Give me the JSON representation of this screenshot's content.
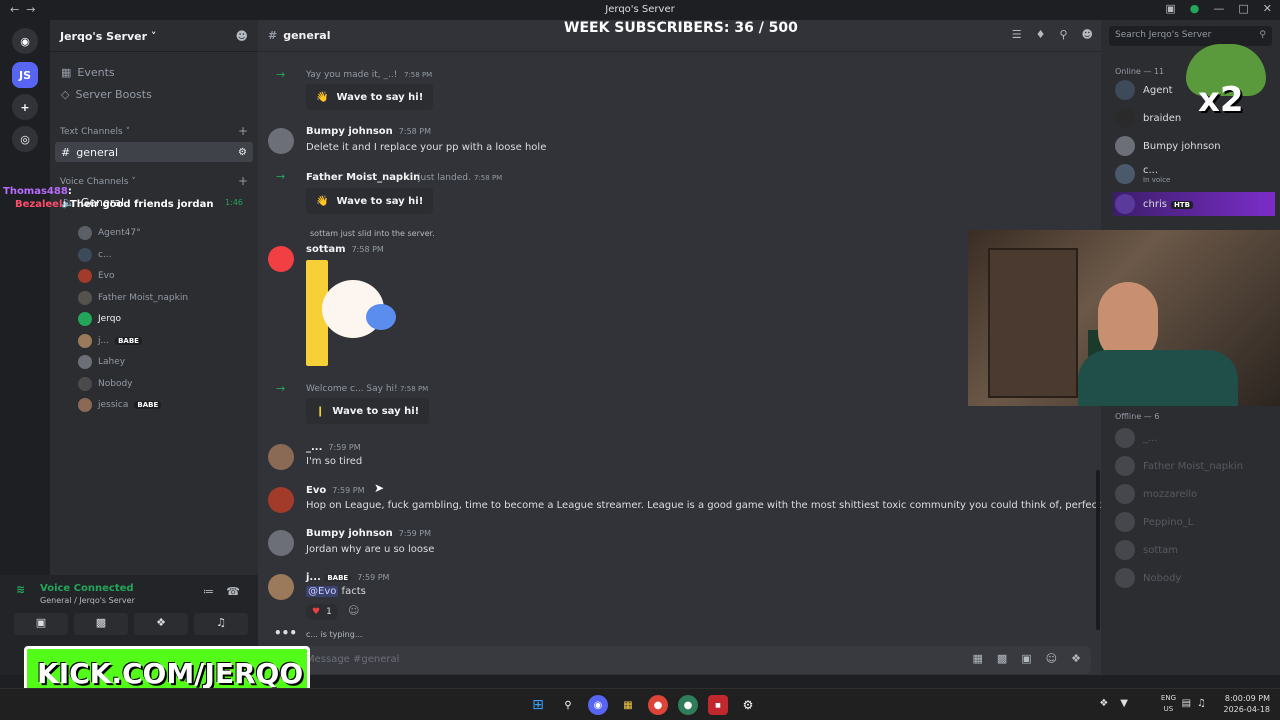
{
  "window": {
    "title": "Jerqo's Server"
  },
  "overlay": {
    "week_subs": "WEEK SUBSCRIBERS: 36 / 500",
    "x2": "x2",
    "kick": "KICK.COM/JERQO"
  },
  "server_rail": {
    "server_initials": "JS"
  },
  "sidebar": {
    "server_name": "Jerqo's Server",
    "events": "Events",
    "boosts": "Server Boosts",
    "text_category": "Text Channels",
    "channel_general": "general",
    "voice_category": "Voice Channels",
    "voice_general": "General",
    "voice_timer": "1:46",
    "voice_members": [
      {
        "name": "Agent47°"
      },
      {
        "name": "c..."
      },
      {
        "name": "Evo"
      },
      {
        "name": "Father Moist_napkin"
      },
      {
        "name": "Jerqo"
      },
      {
        "name": "j...",
        "tag": "BABE"
      },
      {
        "name": "Lahey"
      },
      {
        "name": "Nobody"
      },
      {
        "name": "jessica",
        "tag": "BABE"
      }
    ],
    "chat_overlay": [
      {
        "user": "Thomas488",
        "text": ":"
      },
      {
        "user": "Bezaleel",
        "text": ": Their good friends jordan"
      }
    ],
    "voice_connected": "Voice Connected",
    "voice_sub": "General / Jerqo's Server"
  },
  "chat": {
    "channel": "general",
    "messages": [
      {
        "author": "",
        "time": "7:58 PM",
        "text": "Yay you made it, _..!"
      },
      {
        "author": "Bumpy johnson",
        "time": "7:58 PM",
        "text": "Delete it and I replace your pp with a loose hole"
      },
      {
        "author": "Father Moist_napkin",
        "time": "7:58 PM",
        "text": "just landed."
      },
      {
        "author": "sottam",
        "time": "7:58 PM",
        "text": "sottam just slid into the server."
      },
      {
        "author": "",
        "time": "7:58 PM",
        "text": "Welcome c... Say hi!"
      },
      {
        "author": "_...",
        "time": "7:59 PM",
        "text": "I'm so tired"
      },
      {
        "author": "Evo",
        "time": "7:59 PM",
        "text": "Hop on League, fuck gambling, time to become a League streamer. League is a good game with the most shittiest toxic community you could think of, perfect for you."
      },
      {
        "author": "Bumpy johnson",
        "time": "7:59 PM",
        "text": "Jordan why are u so loose"
      },
      {
        "author": "j...",
        "tag": "BABE",
        "time": "7:59 PM",
        "mention": "@Evo",
        "text": "facts",
        "reaction": "1"
      }
    ],
    "wave_label": "Wave to say hi!",
    "typing": "c... is typing...",
    "composer_placeholder": "Message #general"
  },
  "members": {
    "search_placeholder": "Search Jerqo's Server",
    "online_header": "Online — 11",
    "online": [
      {
        "name": "Agent"
      },
      {
        "name": "braiden"
      },
      {
        "name": "Bumpy johnson"
      },
      {
        "name": "c...",
        "status": "In voice"
      },
      {
        "name": "chris",
        "tag": "HTB"
      }
    ],
    "offline_header": "Offline — 6",
    "offline": [
      {
        "name": "_..."
      },
      {
        "name": "Father Moist_napkin"
      },
      {
        "name": "mozzarello"
      },
      {
        "name": "Peppino_L"
      },
      {
        "name": "sottam"
      },
      {
        "name": "Nobody"
      }
    ]
  },
  "taskbar": {
    "lang1": "ENG",
    "lang2": "US",
    "time": "8:00:09 PM",
    "date": "2026-04-18"
  }
}
